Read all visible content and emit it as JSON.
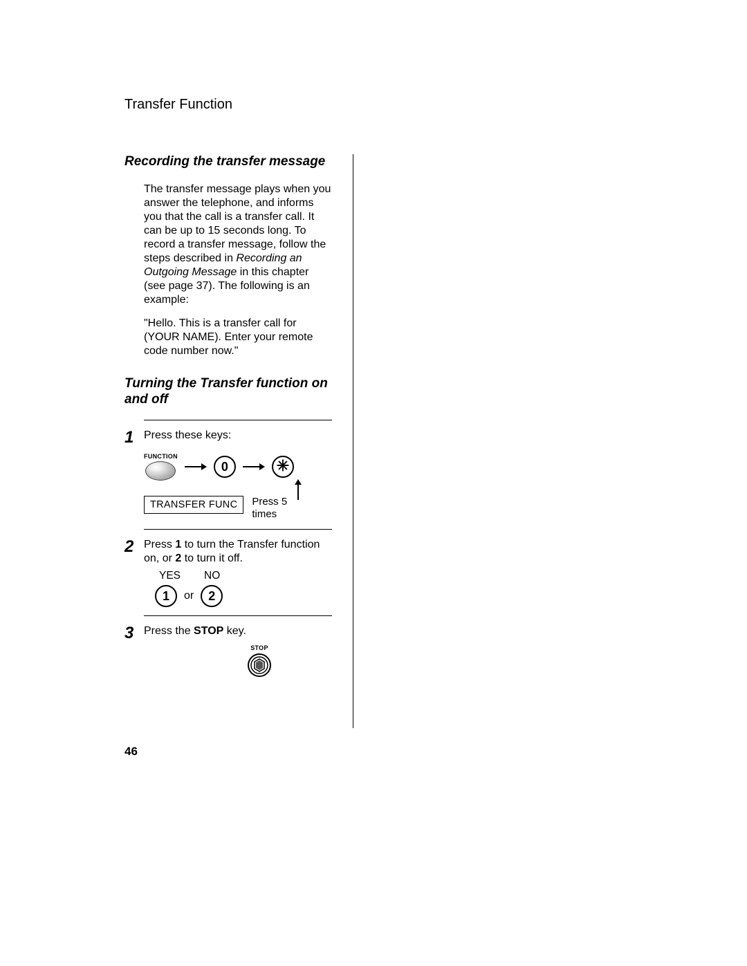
{
  "header": {
    "section": "Transfer Function"
  },
  "section1": {
    "title": "Recording the transfer message",
    "para1a": "The transfer message plays when you answer the telephone, and informs you that the call is a transfer call. It can be up to 15 seconds long. To record a transfer message, follow the steps described in ",
    "para1b_italic": "Recording an Outgoing Message",
    "para1c": " in this chapter (see page 37). The following is an example:",
    "para2": "\"Hello. This is a transfer call for (YOUR NAME). Enter your remote code number now.\""
  },
  "section2": {
    "title": "Turning the Transfer function on and off",
    "step1": {
      "num": "1",
      "text": "Press these keys:",
      "func_label": "FUNCTION",
      "key0": "0",
      "key_star": "✳",
      "display": "TRANSFER FUNC",
      "press_note": "Press 5 times"
    },
    "step2": {
      "num": "2",
      "text_a": "Press ",
      "text_b": "1",
      "text_c": " to turn the Transfer function on, or ",
      "text_d": "2",
      "text_e": " to turn it off.",
      "yes": "YES",
      "no": "NO",
      "or": "or",
      "key1": "1",
      "key2": "2"
    },
    "step3": {
      "num": "3",
      "text_a": "Press the ",
      "text_b": "STOP",
      "text_c": " key.",
      "stop_label": "STOP"
    }
  },
  "page_number": "46"
}
